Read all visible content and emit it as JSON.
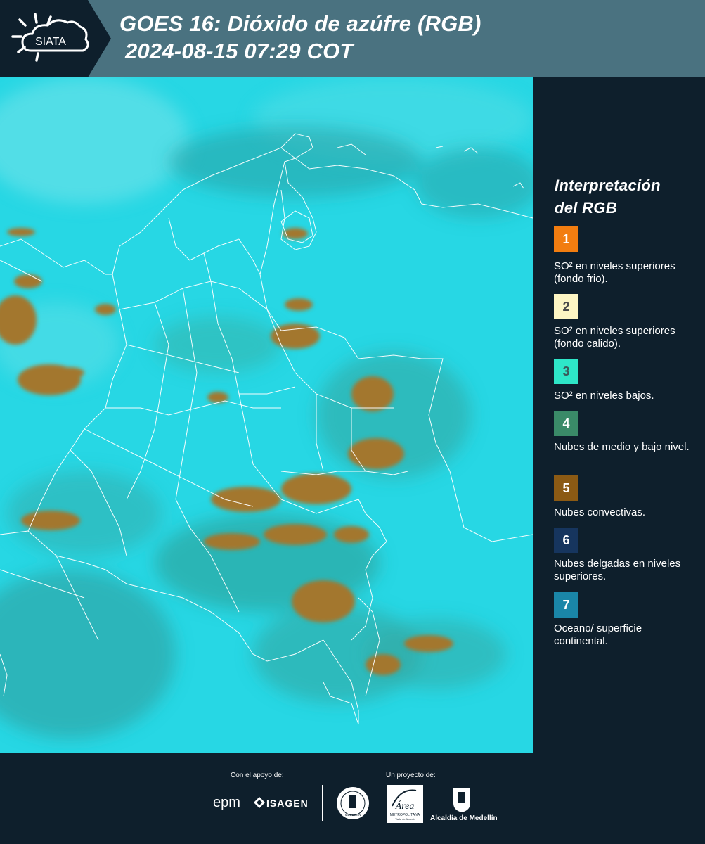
{
  "header": {
    "title_line1": "GOES 16: Dióxido de azúfre (RGB)",
    "title_line2": "2024-08-15 07:29 COT",
    "logo_text": "SIATA",
    "bg_color": "#4a7280",
    "dark_color": "#0e1f2c"
  },
  "map": {
    "product": "GOES 16 SO2 RGB",
    "background_color": "#27d7e4",
    "convective_color": "#a3772e",
    "border_color": "#ffffff"
  },
  "legend": {
    "title_line1": "Interpretación",
    "title_line2": "del RGB",
    "items": [
      {
        "number": "1",
        "color": "#f27d10",
        "number_color": "#ffffff",
        "text": "SO² en niveles superiores (fondo frio)."
      },
      {
        "number": "2",
        "color": "#fdf6c4",
        "number_color": "#4a4a4a",
        "text": "SO² en niveles superiores (fondo calido)."
      },
      {
        "number": "3",
        "color": "#2ee6c8",
        "number_color": "#3a5a5a",
        "text": "SO² en niveles bajos."
      },
      {
        "number": "4",
        "color": "#3a8a68",
        "number_color": "#ffffff",
        "text": "Nubes de medio y bajo nivel."
      },
      {
        "number": "5",
        "color": "#8b5a14",
        "number_color": "#ffffff",
        "text": "Nubes convectivas."
      },
      {
        "number": "6",
        "color": "#16355e",
        "number_color": "#ffffff",
        "text": "Nubes delgadas en niveles superiores."
      },
      {
        "number": "7",
        "color": "#1a86a8",
        "number_color": "#ffffff",
        "text": "Oceano/ superficie continental."
      }
    ]
  },
  "footer": {
    "support_label": "Con el apoyo de:",
    "project_label": "Un proyecto de:",
    "sponsor_epm": "epm",
    "sponsor_isagen": "ISAGEN",
    "seal_text": "MEDELLIN",
    "area_text": "Área",
    "area_subtitle": "METROPOLITANA",
    "area_sub2": "Valle de Aburrá",
    "alcaldia_text": "Alcaldía de Medellín"
  }
}
